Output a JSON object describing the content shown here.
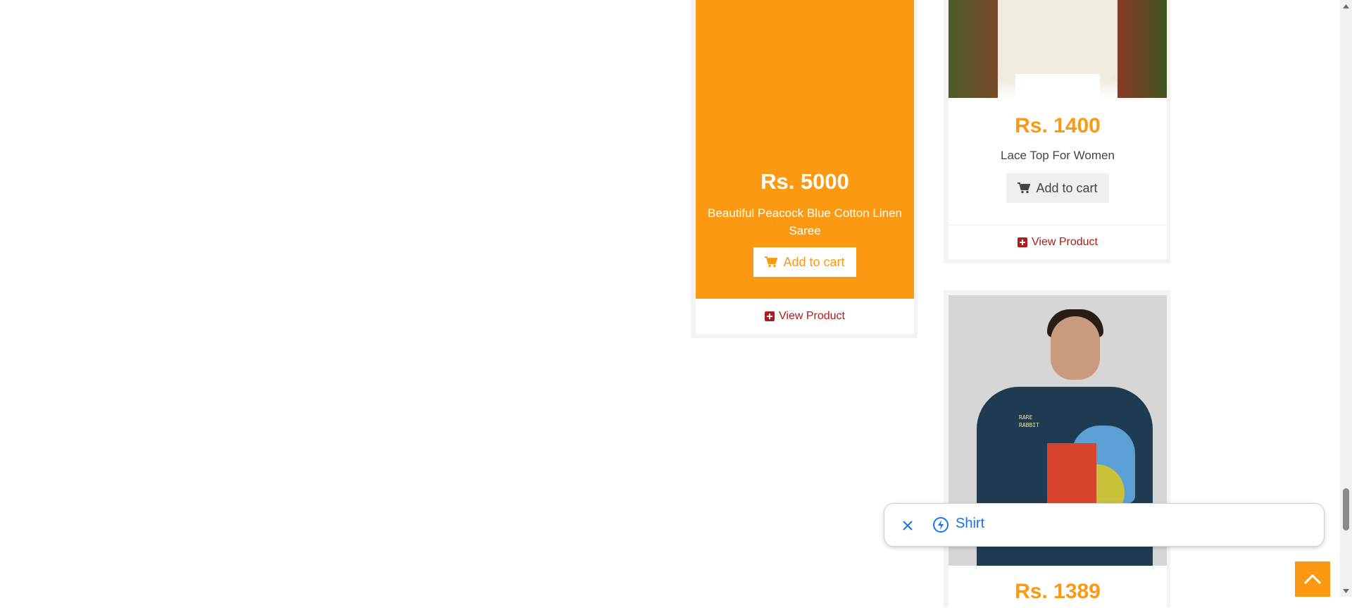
{
  "products": [
    {
      "price": "Rs. 5000",
      "title": "Beautiful Peacock Blue Cotton Linen Saree",
      "cart_label": "Add to cart",
      "view_label": "View Product"
    },
    {
      "price": "Rs. 1400",
      "title": "Lace Top For Women",
      "cart_label": "Add to cart",
      "view_label": "View Product"
    },
    {
      "price": "Rs. 1389",
      "print_text": "RARE\nRABBIT"
    }
  ],
  "suggestion_chip": {
    "label": "Shirt",
    "close_icon": "close-icon",
    "leading_icon": "bolt-icon"
  },
  "colors": {
    "accent": "#fb9913",
    "view_link": "#b01a1a",
    "chip_text": "#1a73e8"
  }
}
